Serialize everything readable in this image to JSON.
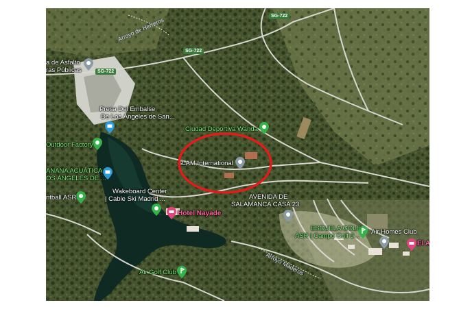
{
  "map": {
    "colors": {
      "forest": "#3d4a2a",
      "water": "#0f2a22",
      "road": "#d8d8d0",
      "highlight": "#e21b1b",
      "green_label": "#7CF27C",
      "pink_label": "#FF5E9C"
    },
    "roads": {
      "sg722_top": "SG-722",
      "sg722_mid": "SG-722",
      "sg722_left": "SG-722"
    },
    "streams": {
      "top": "Arroyo de Herreros",
      "bottom": "Arroyo Maderos"
    },
    "places": {
      "asfalto_line1": "a de Asfalto",
      "asfalto_line2": "ras Públicas",
      "presa_line1": "Presa Del Embalse",
      "presa_line2": "De Los Ángeles de San...",
      "ciudad_deportiva": "Ciudad Deportiva Wanda",
      "outdoor_factory": "Outdoor Factory",
      "slam_international": "SLAM International",
      "manana_line1": "ANANA ACUÁTICA",
      "manana_line2": "OS ÁNGELES DE ...",
      "wakeboard_line1": "Wakeboard Center",
      "wakeboard_line2": "| Cable Ski Madrid ...",
      "paintball": "ntball ASR",
      "hotel_nayade": "Hotel Nayade",
      "avenida_line1": "AVENIDA DE",
      "avenida_line2": "SALAMANCA CASA 23",
      "escuela_line1": "ESCUELA GOLF",
      "escuela_line2": "ASR | Campo Golf 9...",
      "air_homes": "Air Homes Club",
      "el_ai": "El Ai",
      "air_golf": "Air Golf Club"
    },
    "icons": [
      "pin-icon",
      "camera-icon",
      "place-icon",
      "golf-icon",
      "hotel-icon"
    ]
  }
}
